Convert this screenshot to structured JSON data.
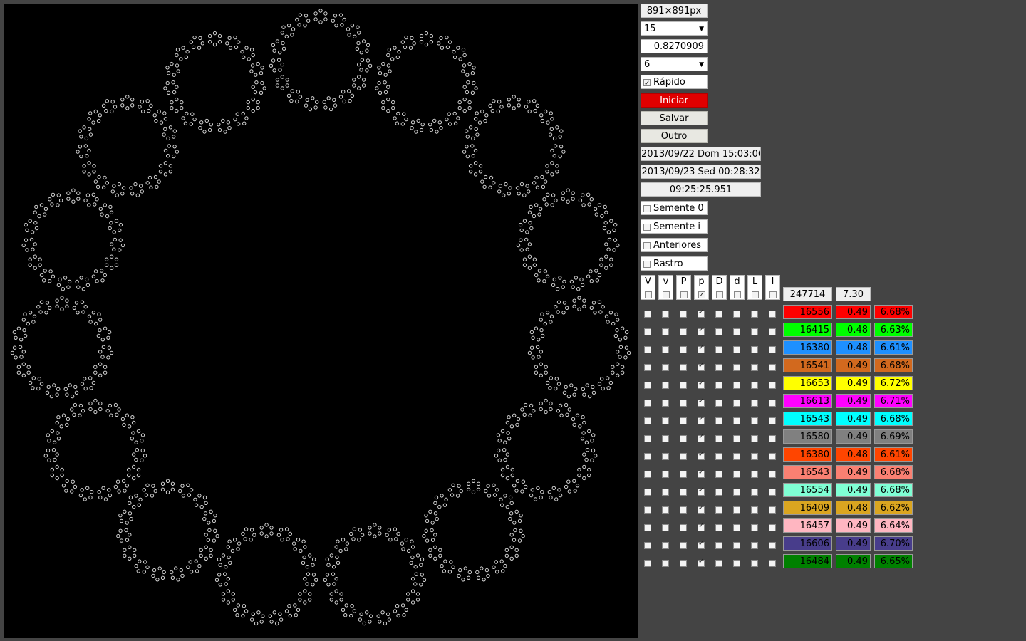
{
  "canvas": {
    "size_label": "891×891px"
  },
  "controls": {
    "select1": "15",
    "value_input": "0.8270909",
    "select2": "6",
    "fast_label": "Rápido",
    "fast_checked": true,
    "start_label": "Iniciar",
    "save_label": "Salvar",
    "other_label": "Outro",
    "start_time": "2013/09/22 Dom 15:03:06",
    "end_time": "2013/09/23 Sed 00:28:32",
    "elapsed": "09:25:25.951",
    "seed0_label": "Semente 0",
    "seedi_label": "Semente i",
    "previous_label": "Anteriores",
    "trace_label": "Rastro"
  },
  "table": {
    "headers": [
      "V",
      "v",
      "P",
      "p",
      "D",
      "d",
      "L",
      "l"
    ],
    "header_checked": [
      false,
      false,
      false,
      true,
      false,
      false,
      false,
      false
    ],
    "total_count": "247714",
    "total_value": "7.30",
    "rows": [
      {
        "count": "16556",
        "ratio": "0.49",
        "pct": "6.68%",
        "color": "#ff0000"
      },
      {
        "count": "16415",
        "ratio": "0.48",
        "pct": "6.63%",
        "color": "#00ff00"
      },
      {
        "count": "16380",
        "ratio": "0.48",
        "pct": "6.61%",
        "color": "#1e90ff"
      },
      {
        "count": "16541",
        "ratio": "0.49",
        "pct": "6.68%",
        "color": "#d2691e"
      },
      {
        "count": "16653",
        "ratio": "0.49",
        "pct": "6.72%",
        "color": "#ffff00"
      },
      {
        "count": "16613",
        "ratio": "0.49",
        "pct": "6.71%",
        "color": "#ff00ff"
      },
      {
        "count": "16543",
        "ratio": "0.49",
        "pct": "6.68%",
        "color": "#00ffff"
      },
      {
        "count": "16580",
        "ratio": "0.49",
        "pct": "6.69%",
        "color": "#808080"
      },
      {
        "count": "16380",
        "ratio": "0.48",
        "pct": "6.61%",
        "color": "#ff4500"
      },
      {
        "count": "16543",
        "ratio": "0.49",
        "pct": "6.68%",
        "color": "#fa8072"
      },
      {
        "count": "16554",
        "ratio": "0.49",
        "pct": "6.68%",
        "color": "#7fffd4"
      },
      {
        "count": "16409",
        "ratio": "0.48",
        "pct": "6.62%",
        "color": "#daa520"
      },
      {
        "count": "16457",
        "ratio": "0.49",
        "pct": "6.64%",
        "color": "#ffb6c1"
      },
      {
        "count": "16606",
        "ratio": "0.49",
        "pct": "6.70%",
        "color": "#483d8b"
      },
      {
        "count": "16484",
        "ratio": "0.49",
        "pct": "6.65%",
        "color": "#008000"
      }
    ]
  }
}
